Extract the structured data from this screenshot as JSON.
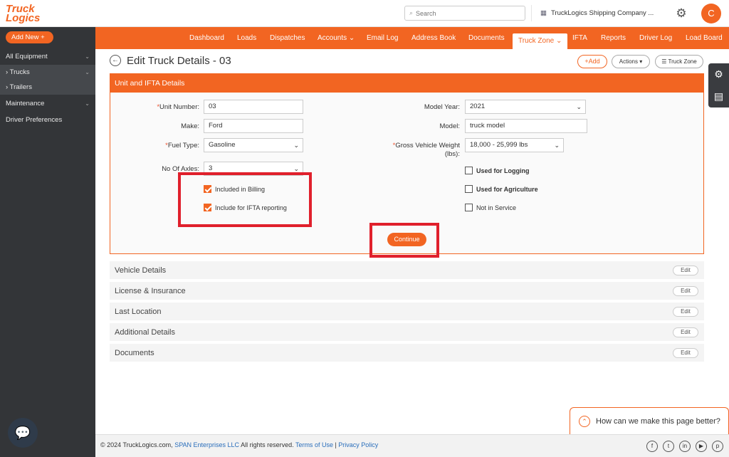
{
  "brand": {
    "line1": "Truck",
    "line2": "Logics"
  },
  "search": {
    "placeholder": "Search"
  },
  "company": {
    "name": "TruckLogics Shipping Company ..."
  },
  "user": {
    "initial": "C"
  },
  "nav": [
    "Dashboard",
    "Loads",
    "Dispatches",
    "Accounts ⌄",
    "Email Log",
    "Address Book",
    "Documents",
    "Truck Zone ⌄",
    "IFTA",
    "Reports",
    "Driver Log",
    "Load Board"
  ],
  "sidebar": {
    "add_new": "Add New  +",
    "items": [
      "All Equipment",
      "Trucks",
      "Trailers",
      "Maintenance",
      "Driver Preferences"
    ]
  },
  "page": {
    "title": "Edit Truck Details - 03",
    "back_icon": "←"
  },
  "actions": {
    "add": "+Add",
    "actions": "Actions ▾",
    "truck_zone": "☰ Truck Zone"
  },
  "panel": {
    "title": "Unit and IFTA Details",
    "unit_number": {
      "label": "Unit Number:",
      "value": "03"
    },
    "make": {
      "label": "Make:",
      "value": "Ford"
    },
    "fuel_type": {
      "label": "Fuel Type:",
      "value": "Gasoline"
    },
    "axles": {
      "label": "No Of Axles:",
      "value": "3"
    },
    "model_year": {
      "label": "Model Year:",
      "value": "2021"
    },
    "model": {
      "label": "Model:",
      "value": "truck model"
    },
    "gvw": {
      "label_line1": "Gross Vehicle Weight",
      "label_line2": "(lbs):",
      "value": "18,000 - 25,999 lbs"
    },
    "checks": {
      "billing": "Included in Billing",
      "ifta": "Include for IFTA reporting",
      "logging": "Used for Logging",
      "agriculture": "Used for Agriculture",
      "not_in_service": "Not in Service"
    },
    "continue": "Continue"
  },
  "sections": [
    {
      "title": "Vehicle Details",
      "edit": "Edit"
    },
    {
      "title": "License & Insurance",
      "edit": "Edit"
    },
    {
      "title": "Last Location",
      "edit": "Edit"
    },
    {
      "title": "Additional Details",
      "edit": "Edit"
    },
    {
      "title": "Documents",
      "edit": "Edit"
    }
  ],
  "feedback": {
    "text": "How can we make this page better?"
  },
  "footer": {
    "copy": "© 2024 TruckLogics.com, ",
    "span": "SPAN Enterprises LLC",
    "rights": " All rights reserved. ",
    "terms": "Terms of Use",
    "sep": " | ",
    "privacy": "Privacy Policy"
  },
  "colors": {
    "accent": "#f26522",
    "sidebar": "#333538",
    "highlight": "#e0202c"
  }
}
